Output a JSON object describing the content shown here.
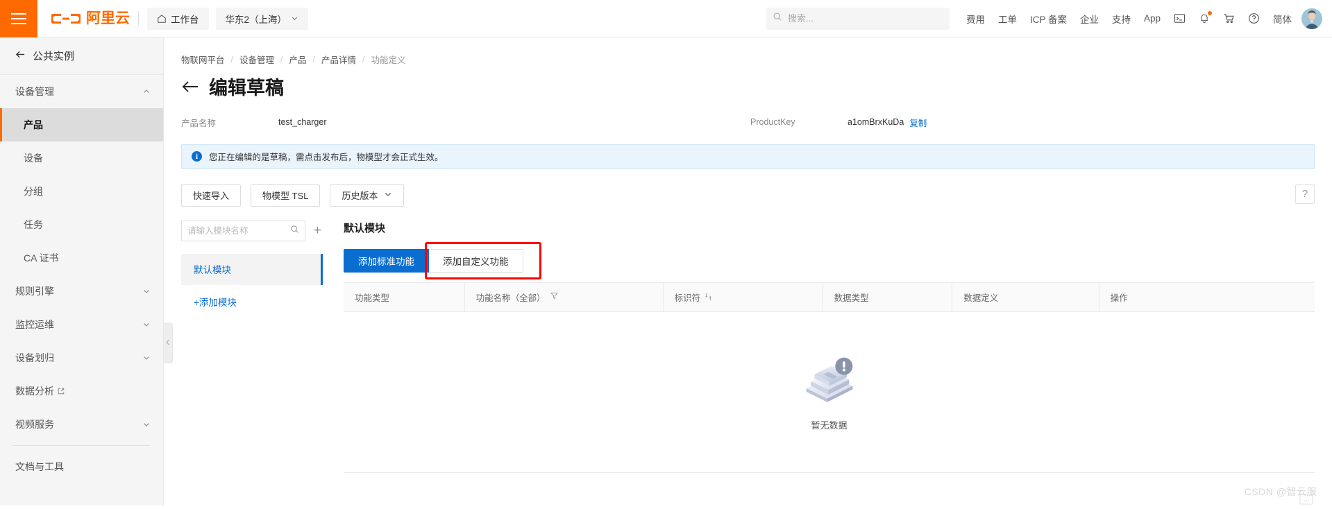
{
  "header": {
    "menu_icon": "hamburger-icon",
    "brand": "阿里云",
    "workbench": "工作台",
    "region": "华东2（上海）",
    "search_placeholder": "搜索...",
    "search_value": "",
    "links": [
      "费用",
      "工单",
      "ICP 备案",
      "企业",
      "支持",
      "App"
    ],
    "icons": [
      "terminal-icon",
      "bell-icon",
      "cart-icon",
      "help-circle-icon"
    ],
    "language": "简体",
    "avatar": "user-avatar"
  },
  "sidebar": {
    "back_label": "公共实例",
    "items": [
      {
        "label": "设备管理",
        "type": "group",
        "expanded": true,
        "chevron": "chevron-up-icon"
      },
      {
        "label": "产品",
        "type": "sub",
        "active": true
      },
      {
        "label": "设备",
        "type": "sub",
        "active": false
      },
      {
        "label": "分组",
        "type": "sub",
        "active": false
      },
      {
        "label": "任务",
        "type": "sub",
        "active": false
      },
      {
        "label": "CA 证书",
        "type": "sub",
        "active": false
      },
      {
        "label": "规则引擎",
        "type": "group",
        "expanded": false,
        "chevron": "chevron-down-icon"
      },
      {
        "label": "监控运维",
        "type": "group",
        "expanded": false,
        "chevron": "chevron-down-icon"
      },
      {
        "label": "设备划归",
        "type": "group",
        "expanded": false,
        "chevron": "chevron-down-icon"
      },
      {
        "label": "数据分析",
        "type": "link",
        "external": true,
        "chevron": "external-link-icon"
      },
      {
        "label": "视频服务",
        "type": "group",
        "expanded": false,
        "chevron": "chevron-down-icon"
      },
      {
        "label": "文档与工具",
        "type": "plain"
      }
    ],
    "collapse_handle": "chevron-left-icon"
  },
  "main": {
    "breadcrumb": [
      "物联网平台",
      "设备管理",
      "产品",
      "产品详情",
      "功能定义"
    ],
    "back_arrow": "arrow-left-icon",
    "page_title": "编辑草稿",
    "meta": [
      {
        "label": "产品名称",
        "value": "test_charger"
      },
      {
        "label": "ProductKey",
        "value": "a1omBrxKuDa",
        "action": "复制"
      }
    ],
    "alert": {
      "icon": "info-icon",
      "text": "您正在编辑的是草稿，需点击发布后，物模型才会正式生效。"
    },
    "toolbar": {
      "buttons": [
        {
          "label": "快速导入"
        },
        {
          "label": "物模型 TSL"
        },
        {
          "label": "历史版本",
          "chevron": "chevron-down-icon"
        }
      ],
      "help_label": "?"
    },
    "module_panel": {
      "search_placeholder": "请输入模块名称",
      "search_value": "",
      "search_icon": "search-icon",
      "add_icon": "plus-icon",
      "items": [
        {
          "label": "默认模块",
          "active": true
        }
      ],
      "add_module_label": "+添加模块"
    },
    "detail_panel": {
      "title": "默认模块",
      "tabs": [
        {
          "label": "添加标准功能",
          "primary": true
        },
        {
          "label": "添加自定义功能",
          "primary": false,
          "highlighted": true
        }
      ],
      "table": {
        "columns": [
          {
            "label": "功能类型"
          },
          {
            "label": "功能名称（全部）",
            "icon": "filter-icon"
          },
          {
            "label": "标识符",
            "icon": "sort-icon"
          },
          {
            "label": "数据类型"
          },
          {
            "label": "数据定义"
          },
          {
            "label": "操作"
          }
        ],
        "rows": [],
        "empty_text": "暂无数据",
        "empty_icon": "empty-box-icon"
      }
    }
  },
  "watermark": "CSDN @智云服",
  "colors": {
    "brand_orange": "#ff6a00",
    "primary_blue": "#0a6ed1",
    "highlight_red": "#ff0000",
    "alert_bg": "#eaf4fd"
  }
}
